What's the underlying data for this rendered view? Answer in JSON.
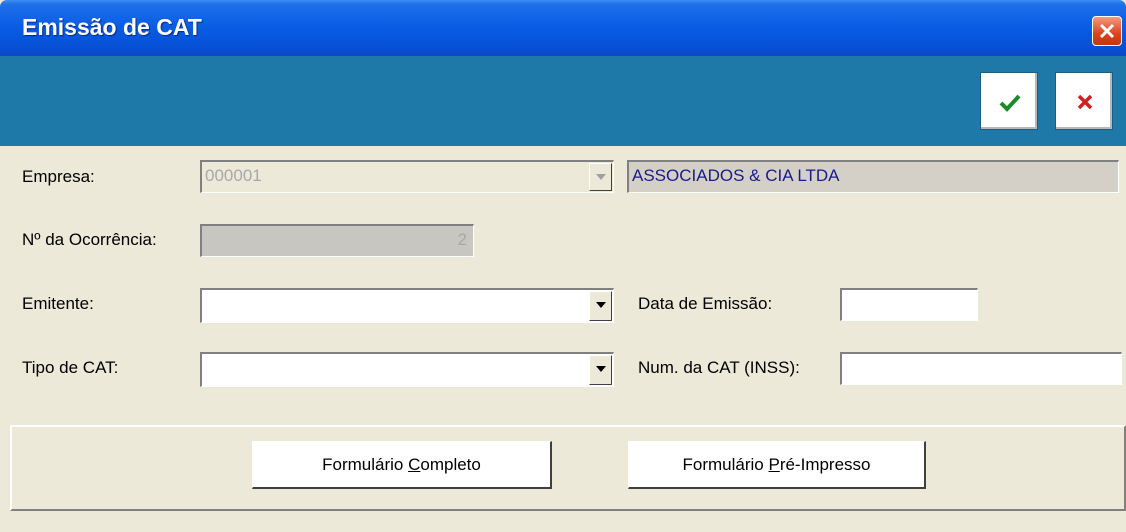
{
  "window": {
    "title": "Emissão de CAT"
  },
  "toolbar": {
    "confirm_icon": "checkmark-icon",
    "cancel_icon": "cross-icon",
    "confirm_color": "#1a8a2a",
    "cancel_color": "#d02020"
  },
  "form": {
    "empresa_label": "Empresa:",
    "empresa_code": "000001",
    "empresa_name": "ASSOCIADOS & CIA LTDA",
    "ocorrencia_label": "Nº da Ocorrência:",
    "ocorrencia_value": "2",
    "emitente_label": "Emitente:",
    "emitente_value": "",
    "data_emissao_label": "Data de Emissão:",
    "data_emissao_value": "",
    "tipo_cat_label": "Tipo de CAT:",
    "tipo_cat_value": "",
    "num_cat_label": "Num. da CAT (INSS):",
    "num_cat_value": ""
  },
  "buttons": {
    "completo_prefix": "Formulário ",
    "completo_accel": "C",
    "completo_suffix": "ompleto",
    "preimpresso_prefix": "Formulário ",
    "preimpresso_accel": "P",
    "preimpresso_suffix": "ré-Impresso"
  },
  "colors": {
    "titlebar": "#0a5ee6",
    "toolbar": "#1e78a8",
    "window_bg": "#ece9d8",
    "empresa_name_text": "#1a1a8c"
  }
}
